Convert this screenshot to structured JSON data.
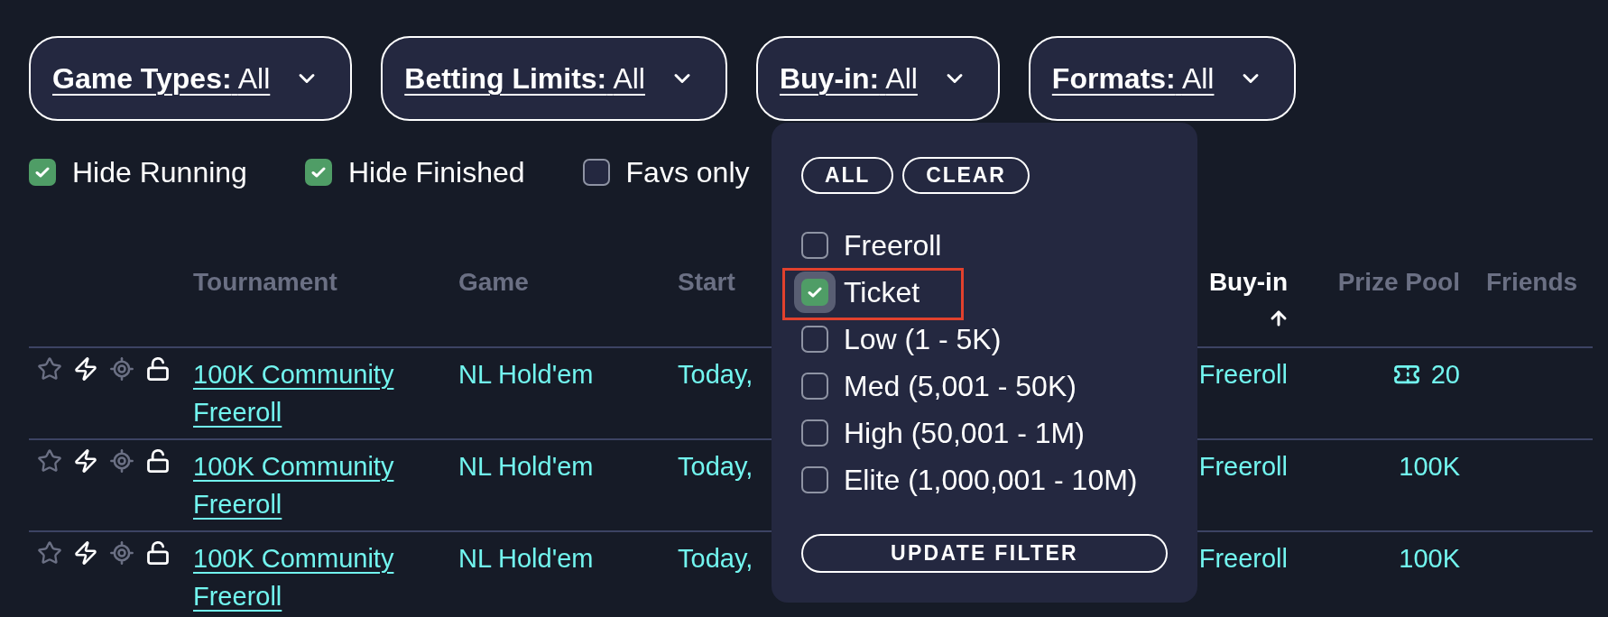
{
  "filters": [
    {
      "label": "Game Types:",
      "value": "All"
    },
    {
      "label": "Betting Limits:",
      "value": "All"
    },
    {
      "label": "Buy-in:",
      "value": "All"
    },
    {
      "label": "Formats:",
      "value": "All"
    }
  ],
  "toggles": [
    {
      "label": "Hide Running",
      "checked": true
    },
    {
      "label": "Hide Finished",
      "checked": true
    },
    {
      "label": "Favs only",
      "checked": false
    }
  ],
  "table": {
    "columns": [
      {
        "label": "Tournament",
        "sorted": false
      },
      {
        "label": "Game",
        "sorted": false
      },
      {
        "label": "Start",
        "sorted": false
      },
      {
        "label": "Buy-in",
        "sorted": true
      },
      {
        "label": "Prize Pool",
        "sorted": false
      },
      {
        "label": "Friends",
        "sorted": false
      }
    ],
    "rows": [
      {
        "favorite": false,
        "tournament": "100K Community Freeroll",
        "game": "NL Hold'em",
        "start": "Today,",
        "buy_in": "Freeroll",
        "ticket": true,
        "prize_pool": "20"
      },
      {
        "favorite": false,
        "tournament": "100K Community Freeroll",
        "game": "NL Hold'em",
        "start": "Today,",
        "buy_in": "Freeroll",
        "ticket": false,
        "prize_pool": "100K"
      },
      {
        "favorite": false,
        "tournament": "100K Community Freeroll",
        "game": "NL Hold'em",
        "start": "Today,",
        "buy_in": "Freeroll",
        "ticket": false,
        "prize_pool": "100K"
      }
    ]
  },
  "buyin_menu": {
    "actions": [
      "ALL",
      "CLEAR"
    ],
    "options": [
      {
        "label": "Freeroll",
        "checked": false,
        "focused": false,
        "highlighted": false
      },
      {
        "label": "Ticket",
        "checked": true,
        "focused": true,
        "highlighted": true
      },
      {
        "label": "Low (1 - 5K)",
        "checked": false,
        "focused": false,
        "highlighted": false
      },
      {
        "label": "Med (5,001 - 50K)",
        "checked": false,
        "focused": false,
        "highlighted": false
      },
      {
        "label": "High (50,001 - 1M)",
        "checked": false,
        "focused": false,
        "highlighted": false
      },
      {
        "label": "Elite (1,000,001 - 10M)",
        "checked": false,
        "focused": false,
        "highlighted": false
      }
    ],
    "submit": "UPDATE FILTER"
  }
}
